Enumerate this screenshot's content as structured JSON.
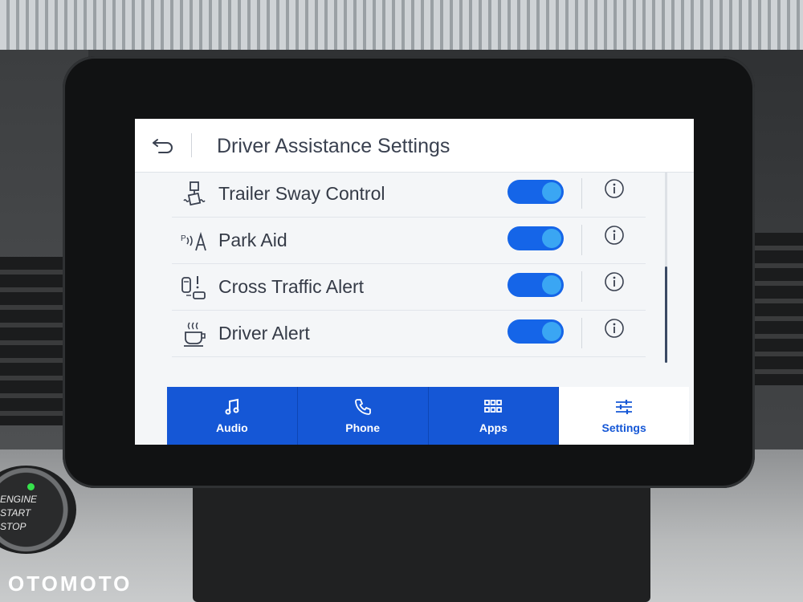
{
  "screen": {
    "title": "Driver Assistance Settings",
    "back_icon": "back-arrow-icon"
  },
  "settings": [
    {
      "label": "Trailer Sway Control",
      "icon": "trailer-sway-icon",
      "enabled": true
    },
    {
      "label": "Park Aid",
      "icon": "park-aid-icon",
      "enabled": true
    },
    {
      "label": "Cross Traffic Alert",
      "icon": "cross-traffic-icon",
      "enabled": true
    },
    {
      "label": "Driver Alert",
      "icon": "coffee-cup-icon",
      "enabled": true
    }
  ],
  "nav": [
    {
      "label": "Audio",
      "icon": "music-note-icon",
      "active": false
    },
    {
      "label": "Phone",
      "icon": "phone-icon",
      "active": false
    },
    {
      "label": "Apps",
      "icon": "grid-icon",
      "active": false
    },
    {
      "label": "Settings",
      "icon": "sliders-icon",
      "active": true
    }
  ],
  "engine_button": {
    "line1": "ENGINE",
    "line2": "START",
    "line3": "STOP"
  },
  "watermark": "OTOMOTO",
  "colors": {
    "accent": "#1557d6",
    "toggle_on": "#1565e8",
    "toggle_knob": "#3aa6f3",
    "engine_led": "#36e24c"
  }
}
